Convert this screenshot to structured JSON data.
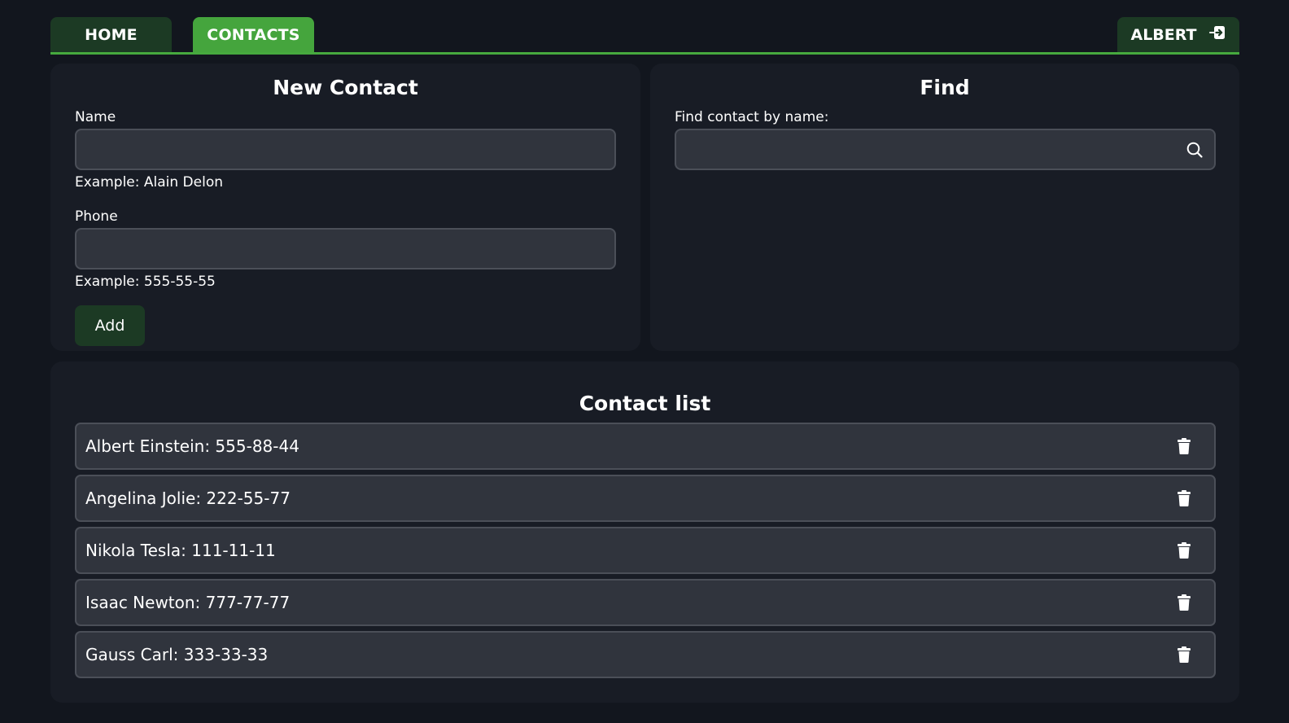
{
  "nav": {
    "tabs": [
      {
        "label": "HOME"
      },
      {
        "label": "CONTACTS"
      }
    ],
    "user_label": "ALBERT",
    "logout_icon": "logout-icon",
    "accent_color": "#45a53d"
  },
  "new_contact": {
    "title": "New Contact",
    "name_label": "Name",
    "name_value": "",
    "name_hint": "Example: Alain Delon",
    "phone_label": "Phone",
    "phone_value": "",
    "phone_hint": "Example: 555-55-55",
    "add_label": "Add"
  },
  "find": {
    "title": "Find",
    "label": "Find contact by name:",
    "value": "",
    "icon": "search-icon"
  },
  "contact_list": {
    "title": "Contact list",
    "items": [
      {
        "text": "Albert Einstein: 555-88-44"
      },
      {
        "text": "Angelina Jolie: 222-55-77"
      },
      {
        "text": "Nikola Tesla: 111-11-11"
      },
      {
        "text": "Isaac Newton: 777-77-77"
      },
      {
        "text": "Gauss Carl: 333-33-33"
      }
    ],
    "delete_icon": "trash-icon"
  }
}
